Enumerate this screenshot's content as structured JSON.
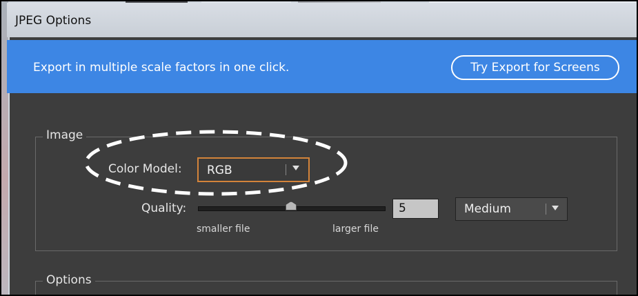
{
  "window": {
    "title": "JPEG Options"
  },
  "banner": {
    "text": "Export in multiple scale factors in one click.",
    "button_label": "Try Export for Screens",
    "color": "#3d86e4"
  },
  "image_group": {
    "legend": "Image",
    "color_model": {
      "label": "Color Model:",
      "value": "RGB"
    },
    "quality": {
      "label": "Quality:",
      "value": "5",
      "slider_min_label": "smaller file",
      "slider_max_label": "larger file",
      "preset": "Medium"
    }
  },
  "options_group": {
    "legend": "Options"
  },
  "colors": {
    "dialog_bg": "#3d3d3d",
    "focus_accent": "#d4843a"
  }
}
